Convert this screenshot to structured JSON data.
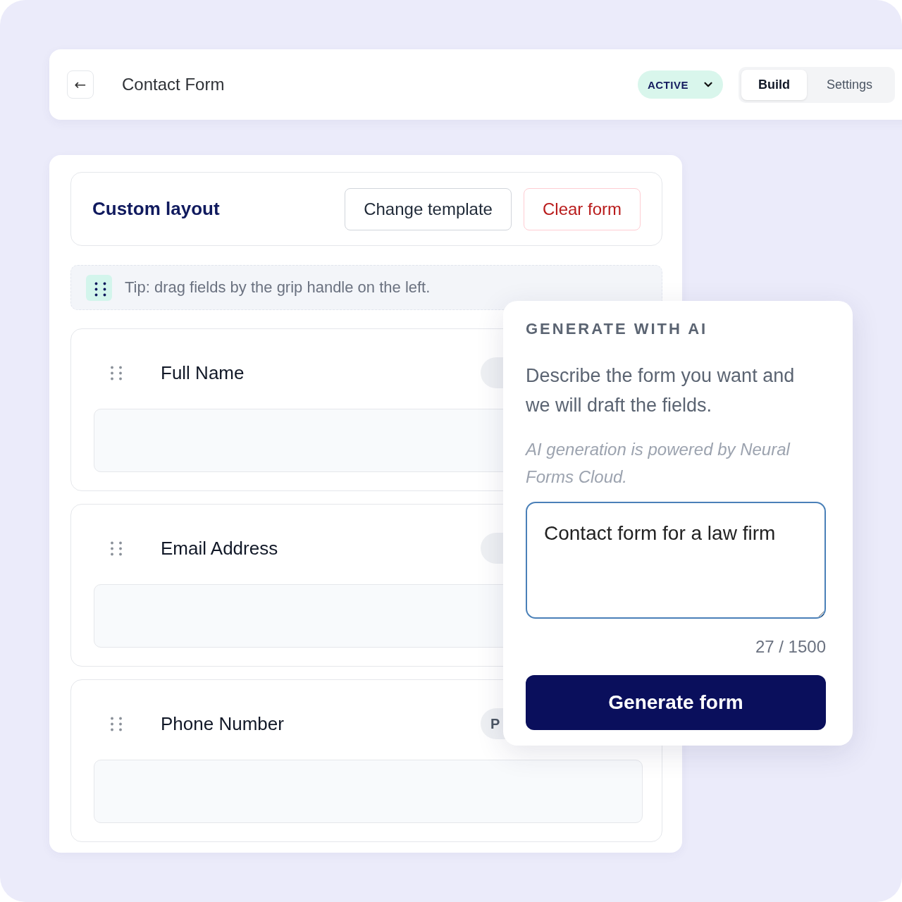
{
  "header": {
    "back_button": "←",
    "title": "Contact Form",
    "status": {
      "label": "ACTIVE"
    },
    "tabs": [
      {
        "label": "Build",
        "selected": true
      },
      {
        "label": "Settings",
        "selected": false
      }
    ]
  },
  "layout_bar": {
    "title": "Custom layout",
    "buttons": [
      {
        "label": "Change template",
        "kind": "default"
      },
      {
        "label": "Clear form",
        "kind": "danger"
      }
    ]
  },
  "tip": "Tip: drag fields by the grip handle on the left.",
  "fields": [
    {
      "label": "Full Name"
    },
    {
      "label": "Email Address"
    },
    {
      "label": "Phone Number",
      "badge": "P"
    }
  ],
  "ai_panel": {
    "title": "GENERATE WITH AI",
    "description": "Describe the form you want and we will draft the fields.",
    "note": "AI generation is powered by Neural Forms Cloud.",
    "prompt": {
      "value": "Contact form for a law firm"
    },
    "counter": "27 / 1500",
    "button": "Generate form"
  }
}
